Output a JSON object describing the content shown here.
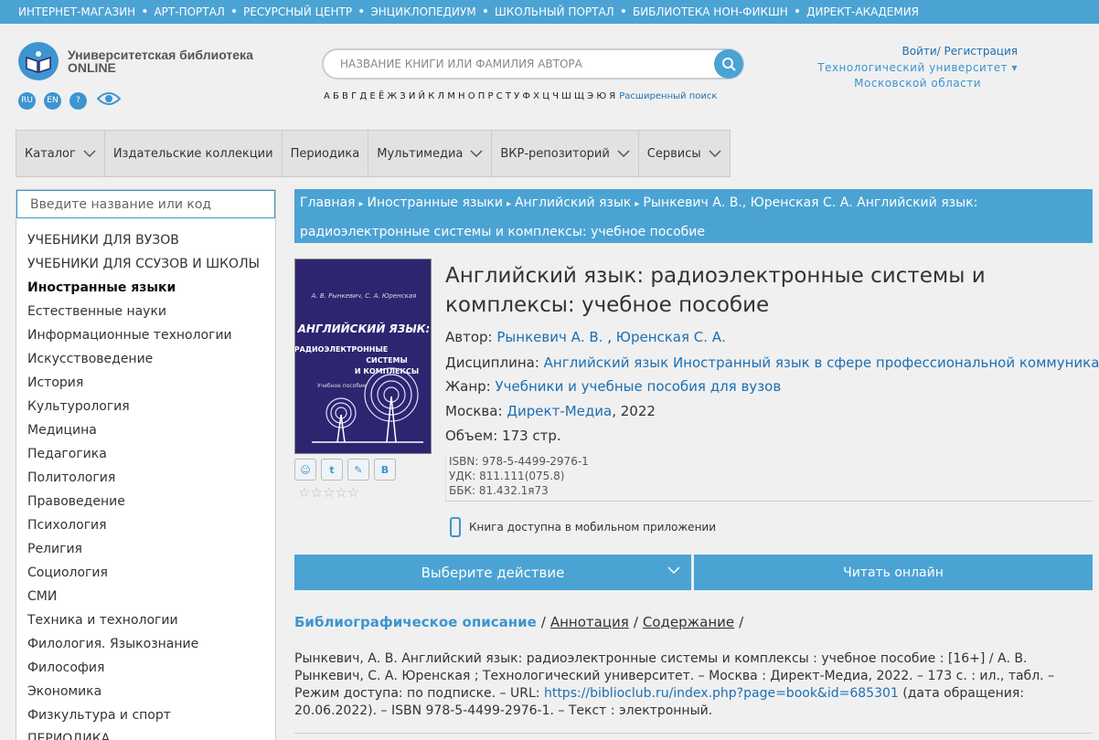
{
  "top_strip": {
    "links": [
      "ИНТЕРНЕТ-МАГАЗИН",
      "АРТ-ПОРТАЛ",
      "РЕСУРСНЫЙ ЦЕНТР",
      "ЭНЦИКЛОПЕДИУМ",
      "ШКОЛЬНЫЙ ПОРТАЛ",
      "БИБЛИОТЕКА НОН-ФИКШН",
      "ДИРЕКТ-АКАДЕМИЯ"
    ],
    "separator": "•"
  },
  "header": {
    "logo_line1": "Университетская библиотека",
    "logo_line2": "ONLINE",
    "lang_ru": "RU",
    "lang_en": "EN",
    "help": "?",
    "search_placeholder": "НАЗВАНИЕ КНИГИ ИЛИ ФАМИЛИЯ АВТОРА",
    "alphabet": "А Б В Г Д Е Ё Ж З И Й К Л М Н О П Р С Т У Ф Х Ц Ч Ш Щ Э Ю Я",
    "advanced_search": "Расширенный поиск",
    "login": "Войти/ Регистрация",
    "university_line1": "Технологический университет ▾",
    "university_line2": "Московской области"
  },
  "nav": {
    "items": [
      {
        "label": "Каталог",
        "has_dropdown": true
      },
      {
        "label": "Издательские коллекции",
        "has_dropdown": false
      },
      {
        "label": "Периодика",
        "has_dropdown": false
      },
      {
        "label": "Мультимедиа",
        "has_dropdown": true
      },
      {
        "label": "ВКР-репозиторий",
        "has_dropdown": true
      },
      {
        "label": "Сервисы",
        "has_dropdown": true
      }
    ]
  },
  "sidebar": {
    "search_placeholder": "Введите название или код",
    "categories": [
      "УЧЕБНИКИ ДЛЯ ВУЗОВ",
      "УЧЕБНИКИ ДЛЯ ССУЗОВ И ШКОЛЫ",
      "Иностранные языки",
      "Естественные науки",
      "Информационные технологии",
      "Искусствоведение",
      "История",
      "Культурология",
      "Медицина",
      "Педагогика",
      "Политология",
      "Правоведение",
      "Психология",
      "Религия",
      "Социология",
      "СМИ",
      "Техника и технологии",
      "Филология. Языкознание",
      "Философия",
      "Экономика",
      "Физкультура и спорт",
      "ПЕРИОДИКА"
    ],
    "active_index": 2
  },
  "breadcrumb": [
    "Главная",
    "Иностранные языки",
    "Английский язык",
    "Рынкевич А. В., Юренская С. А. Английский язык: радиоэлектронные системы и комплексы: учебное пособие"
  ],
  "book": {
    "cover_authors": "А. В. Рынкевич, С. А. Юренская",
    "cover_title1": "АНГЛИЙСКИЙ ЯЗЫК:",
    "cover_title2": "РАДИОЭЛЕКТРОННЫЕ",
    "cover_title3": "СИСТЕМЫ",
    "cover_title4": "И КОМПЛЕКСЫ",
    "cover_subtitle": "Учебное пособие",
    "title": "Английский язык: радиоэлектронные системы и комплексы: учебное пособие",
    "author_label": "Автор:",
    "author_1": "Рынкевич А. В.",
    "author_2": "Юренская С. А.",
    "discipline_label": "Дисциплина:",
    "discipline_1": "Английский язык",
    "discipline_2": "Иностранный язык в сфере профессиональной коммуникации",
    "genre_label": "Жанр:",
    "genre": "Учебники и учебные пособия для вузов",
    "city": "Москва:",
    "publisher": "Директ-Медиа",
    "year": ", 2022",
    "volume": "Объем: 173 стр.",
    "isbn": "ISBN: 978-5-4499-2976-1",
    "udk": "УДК: 811.111(075.8)",
    "bbk": "ББК: 81.432.1я73",
    "mobile_note": "Книга доступна в мобильном приложении",
    "stars": "☆☆☆☆☆",
    "share_1": "☺",
    "share_2": "t",
    "share_3": "✎",
    "share_4": "В"
  },
  "actions": {
    "choose": "Выберите действие",
    "read_online": "Читать онлайн"
  },
  "tabs": {
    "biblio": "Библиографическое описание",
    "annotation": "Аннотация",
    "contents": "Содержание",
    "slash": "/"
  },
  "description": {
    "text_before": "Рынкевич, А. В. Английский язык: радиоэлектронные системы и комплексы : учебное пособие : [16+] / А. В. Рынкевич, С. А. Юренская ; Технологический университет. – Москва : Директ-Медиа, 2022. – 173 с. : ил., табл. – Режим доступа: по подписке. – URL: ",
    "url": "https://biblioclub.ru/index.php?page=book&id=685301",
    "text_after": " (дата обращения: 20.06.2022). – ISBN 978-5-4499-2976-1. – Текст : электронный."
  },
  "colors": {
    "accent": "#4ba3d4",
    "link": "#1b6fb5",
    "cover_bg": "#2d2570"
  }
}
